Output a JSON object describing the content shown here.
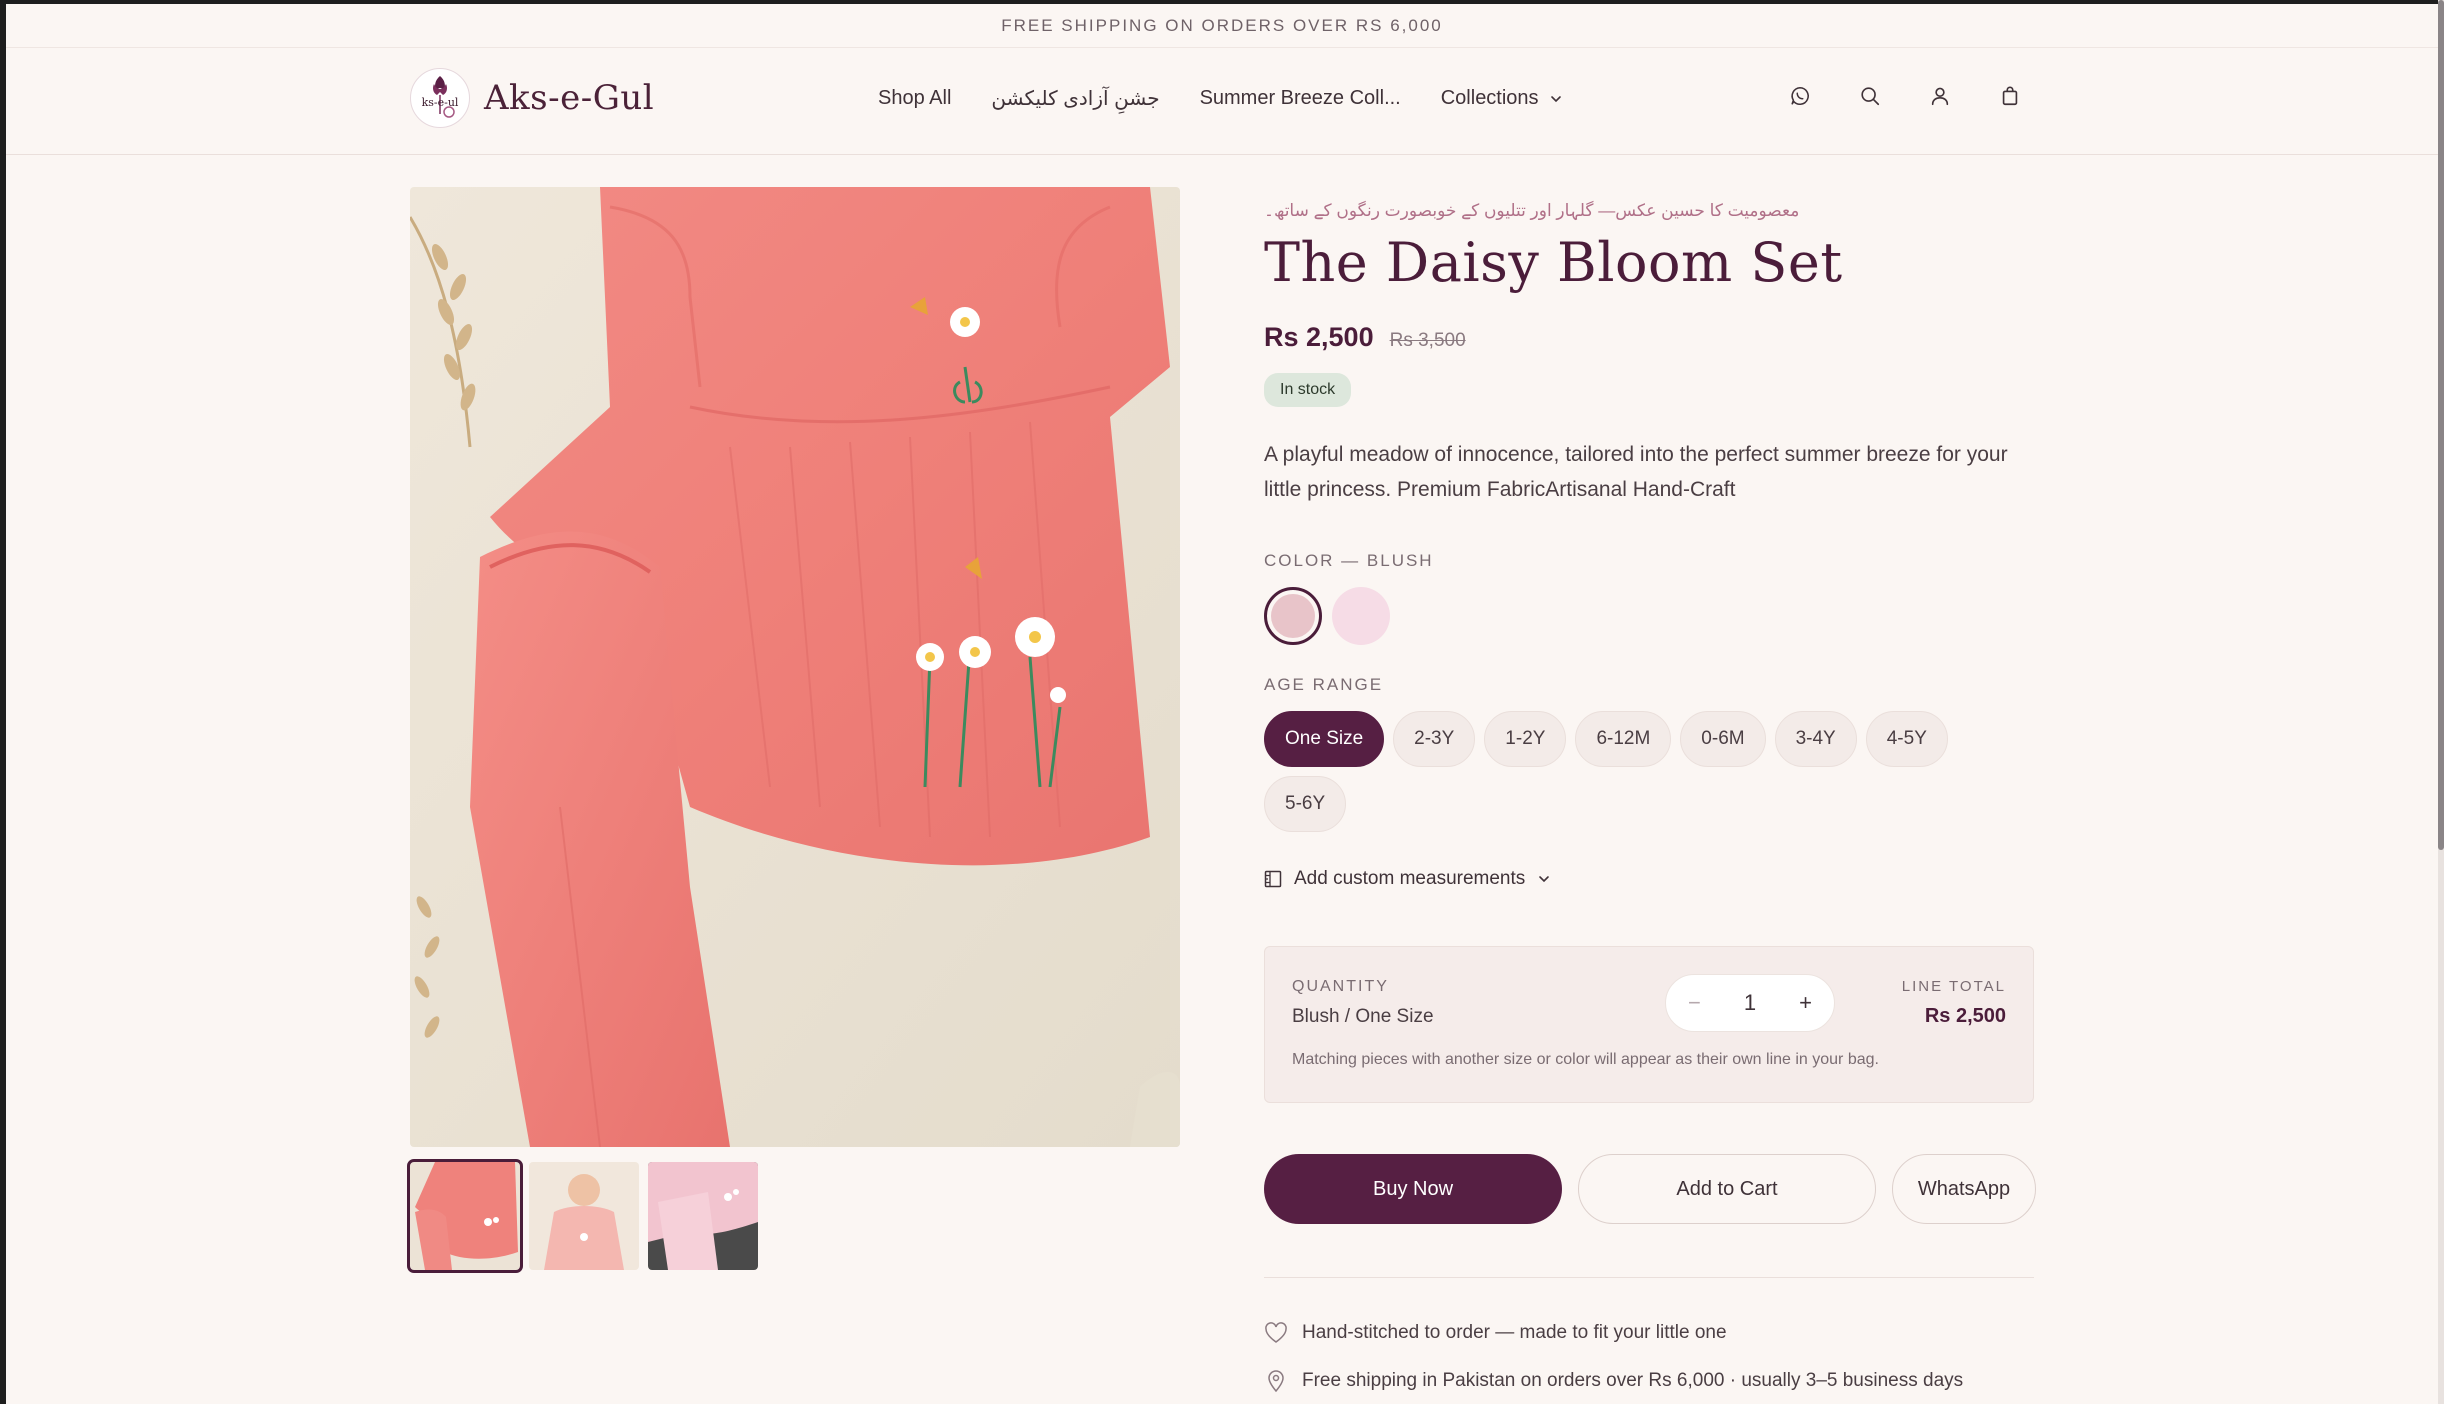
{
  "announcement": "FREE SHIPPING ON ORDERS OVER RS 6,000",
  "brand": {
    "name": "Aks-e-Gul",
    "logo_text": "ks-e-ul"
  },
  "nav": {
    "items": [
      {
        "label": "Shop All"
      },
      {
        "label": "جشنِ آزادی کلیکشن"
      },
      {
        "label": "Summer Breeze Coll..."
      },
      {
        "label": "Collections"
      }
    ]
  },
  "header_icons": [
    "whatsapp-icon",
    "search-icon",
    "account-icon",
    "bag-icon"
  ],
  "product": {
    "urdu_tagline": "معصومیت کا حسین عکس— گلہار اور تتلیوں کے خوبصورت رنگوں کے ساتھ۔",
    "title": "The Daisy Bloom Set",
    "price": "Rs 2,500",
    "compare_price": "Rs 3,500",
    "stock": "In stock",
    "description": "A playful meadow of innocence, tailored into the perfect summer breeze for your little princess. Premium FabricArtisanal Hand-Craft",
    "color_label": "COLOR — BLUSH",
    "colors": [
      {
        "name": "Blush",
        "hex": "#e8c4c9",
        "selected": true
      },
      {
        "name": "Pink",
        "hex": "#f6dce6",
        "selected": false
      }
    ],
    "age_label": "AGE RANGE",
    "sizes": [
      {
        "label": "One Size",
        "selected": true
      },
      {
        "label": "2-3Y",
        "selected": false
      },
      {
        "label": "1-2Y",
        "selected": false
      },
      {
        "label": "6-12M",
        "selected": false
      },
      {
        "label": "0-6M",
        "selected": false
      },
      {
        "label": "3-4Y",
        "selected": false
      },
      {
        "label": "4-5Y",
        "selected": false
      },
      {
        "label": "5-6Y",
        "selected": false
      }
    ],
    "custom_measurements": "Add custom measurements"
  },
  "quantity": {
    "label": "QUANTITY",
    "variant": "Blush / One Size",
    "minus": "−",
    "value": "1",
    "plus": "+",
    "line_total_label": "LINE TOTAL",
    "line_total": "Rs 2,500",
    "note": "Matching pieces with another size or color will appear as their own line in your bag."
  },
  "actions": {
    "buy_now": "Buy Now",
    "add_to_cart": "Add to Cart",
    "whatsapp": "WhatsApp"
  },
  "perks": [
    "Hand-stitched to order — made to fit your little one",
    "Free shipping in Pakistan on orders over Rs 6,000 · usually 3–5 business days"
  ],
  "colors": {
    "accent": "#561f43",
    "background": "#fbf6f3",
    "title": "#4b1d3a"
  }
}
